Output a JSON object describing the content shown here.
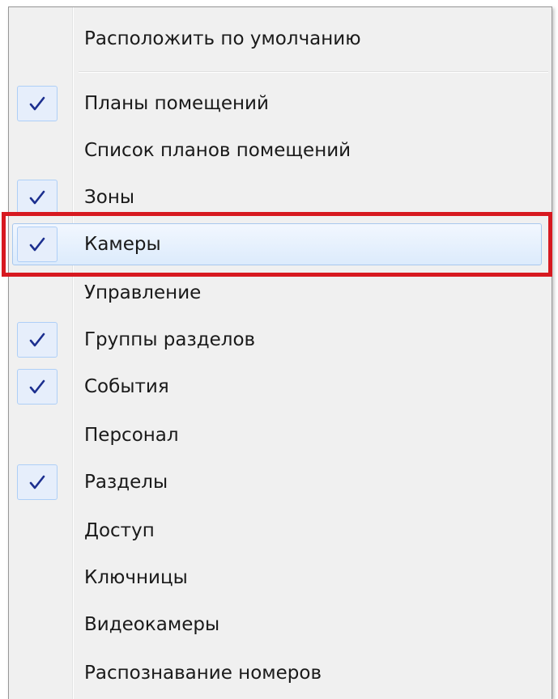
{
  "menu": {
    "items": [
      {
        "label": "Расположить по умолчанию",
        "checked": false
      },
      {
        "label": "Планы помещений",
        "checked": true
      },
      {
        "label": "Список планов помещений",
        "checked": false
      },
      {
        "label": "Зоны",
        "checked": true
      },
      {
        "label": "Камеры",
        "checked": true,
        "hovered": true
      },
      {
        "label": "Управление",
        "checked": false
      },
      {
        "label": "Группы разделов",
        "checked": true
      },
      {
        "label": "События",
        "checked": true
      },
      {
        "label": "Персонал",
        "checked": false
      },
      {
        "label": "Разделы",
        "checked": true
      },
      {
        "label": "Доступ",
        "checked": false
      },
      {
        "label": "Ключницы",
        "checked": false
      },
      {
        "label": "Видеокамеры",
        "checked": false
      },
      {
        "label": "Распознавание номеров",
        "checked": false
      }
    ]
  },
  "colors": {
    "menu_bg": "#f0f0f0",
    "check": "#1c2f8f",
    "hover_border": "#a8c8ee",
    "annotation": "#d71920"
  },
  "icons": {
    "check": "checkmark-icon"
  }
}
